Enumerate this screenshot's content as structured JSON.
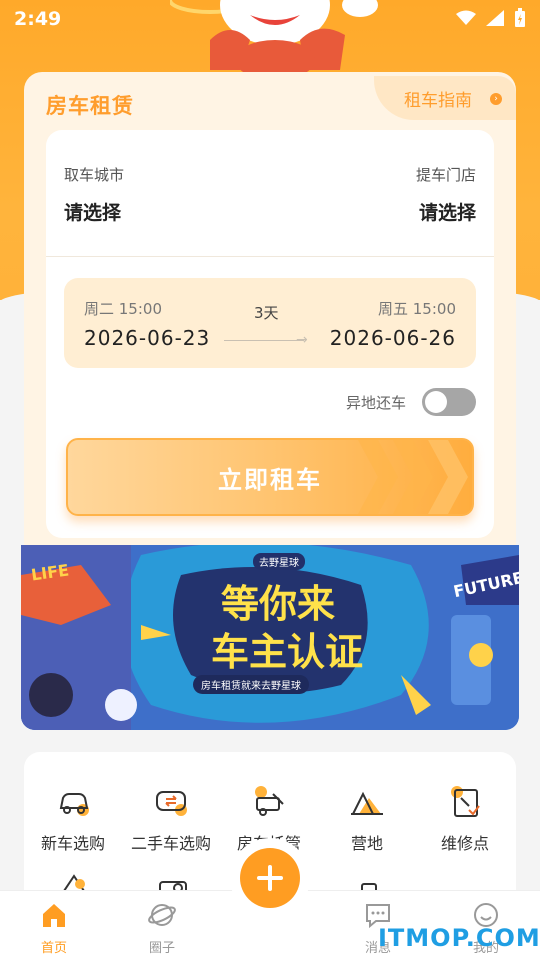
{
  "status_bar": {
    "time": "2:49"
  },
  "card": {
    "title": "房车租赁",
    "guide_label": "租车指南",
    "pickup_city_label": "取车城市",
    "pickup_city_value": "请选择",
    "store_label": "提车门店",
    "store_value": "请选择",
    "start_day": "周二 15:00",
    "start_date": "2026-06-23",
    "end_day": "周五 15:00",
    "end_date": "2026-06-26",
    "days": "3天",
    "remote_return_label": "异地还车",
    "remote_return_on": false,
    "rent_button": "立即租车"
  },
  "banner": {
    "headline_1": "等你来",
    "headline_2": "车主认证",
    "caption": "房车租赁就来去野星球",
    "badge": "去野星球",
    "future_sign": "FUTURE",
    "life_sign": "LIFE"
  },
  "features": [
    {
      "label": "新车选购",
      "icon": "new-car-icon"
    },
    {
      "label": "二手车选购",
      "icon": "used-car-icon"
    },
    {
      "label": "房车托管",
      "icon": "rv-custody-icon"
    },
    {
      "label": "营地",
      "icon": "campsite-icon"
    },
    {
      "label": "维修点",
      "icon": "repair-icon"
    }
  ],
  "tabbar": {
    "home": "首页",
    "circle": "圈子",
    "message": "消息",
    "mine": "我的"
  },
  "watermark": "ITMOP.COM",
  "colors": {
    "accent": "#ff9d22",
    "accent_light": "#ffeed3",
    "banner_blue": "#3e6fc9"
  }
}
